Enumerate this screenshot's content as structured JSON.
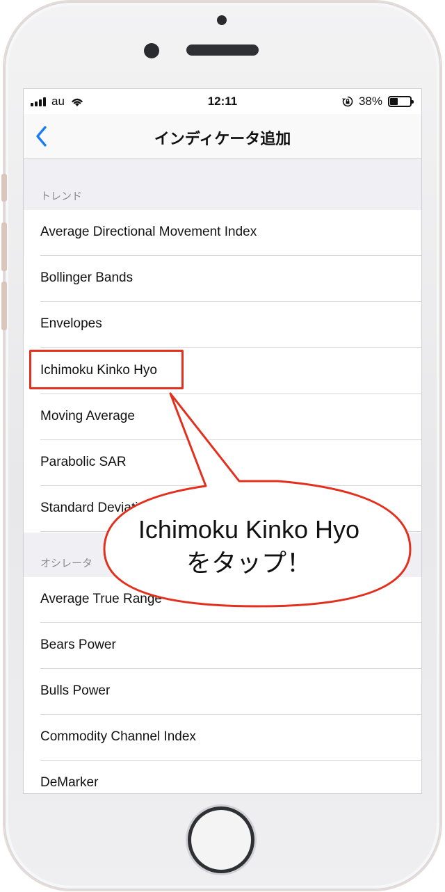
{
  "status_bar": {
    "carrier": "au",
    "time": "12:11",
    "battery_percent": "38%",
    "battery_level": 0.38
  },
  "nav": {
    "title": "インディケータ追加",
    "back_icon": "chevron-left-icon"
  },
  "sections": [
    {
      "header": "トレンド",
      "items": [
        "Average Directional Movement Index",
        "Bollinger Bands",
        "Envelopes",
        "Ichimoku Kinko Hyo",
        "Moving Average",
        "Parabolic SAR",
        "Standard Deviation"
      ]
    },
    {
      "header": "オシレータ",
      "items": [
        "Average True Range",
        "Bears Power",
        "Bulls Power",
        "Commodity Channel Index",
        "DeMarker"
      ]
    }
  ],
  "callout": {
    "line1": "Ichimoku Kinko Hyo",
    "line2": "をタップ！",
    "color": "#e3301e"
  }
}
